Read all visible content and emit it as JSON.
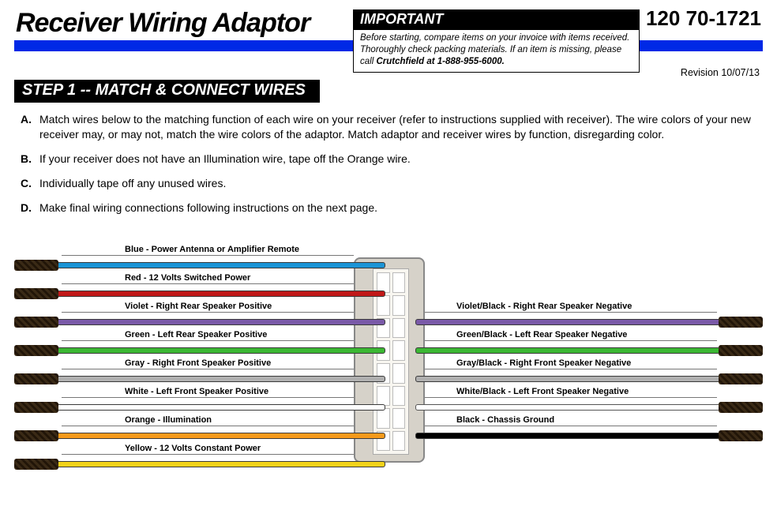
{
  "header": {
    "title": "Receiver Wiring Adaptor",
    "part_number": "120 70-1721",
    "revision": "Revision 10/07/13"
  },
  "important": {
    "heading": "IMPORTANT",
    "body_1": "Before starting, compare items on your invoice with items received. Thoroughly check packing materials. If an item is missing, please call ",
    "body_strong": "Crutchfield at 1-888-955-6000."
  },
  "step": {
    "heading": "STEP 1 -- MATCH & CONNECT WIRES"
  },
  "instructions": [
    {
      "letter": "A.",
      "text": "Match wires below to the matching function of each wire on your receiver (refer to instructions supplied with receiver).  The wire colors of your new receiver may, or may not, match the wire colors of the adaptor.  Match adaptor and receiver wires by function, disregarding color."
    },
    {
      "letter": "B.",
      "text": "If your receiver does not have an Illumination wire, tape off the Orange wire."
    },
    {
      "letter": "C.",
      "text": "Individually tape off any unused wires."
    },
    {
      "letter": "D.",
      "text": "Make final wiring connections following instructions on the next page."
    }
  ],
  "wires": {
    "left": [
      {
        "label": "Blue - Power Antenna or Amplifier Remote",
        "color": "#1a94d6"
      },
      {
        "label": "Red - 12 Volts Switched Power",
        "color": "#c01818"
      },
      {
        "label": "Violet - Right Rear Speaker Positive",
        "color": "#7a5aa8"
      },
      {
        "label": "Green - Left Rear Speaker Positive",
        "color": "#3bb733"
      },
      {
        "label": "Gray - Right Front Speaker Positive",
        "color": "#b0b0b0"
      },
      {
        "label": "White - Left Front Speaker Positive",
        "color": "#ffffff"
      },
      {
        "label": "Orange - Illumination",
        "color": "#f59a1b"
      },
      {
        "label": "Yellow - 12 Volts Constant Power",
        "color": "#f2d21a"
      }
    ],
    "right": [
      {
        "label": "Violet/Black - Right Rear Speaker Negative",
        "color": "#7a5aa8",
        "row": 2
      },
      {
        "label": "Green/Black - Left Rear Speaker Negative",
        "color": "#3bb733",
        "row": 3
      },
      {
        "label": "Gray/Black - Right Front Speaker Negative",
        "color": "#b0b0b0",
        "row": 4
      },
      {
        "label": "White/Black - Left Front Speaker Negative",
        "color": "#ffffff",
        "row": 5
      },
      {
        "label": "Black - Chassis Ground",
        "color": "#000000",
        "row": 6
      }
    ]
  }
}
